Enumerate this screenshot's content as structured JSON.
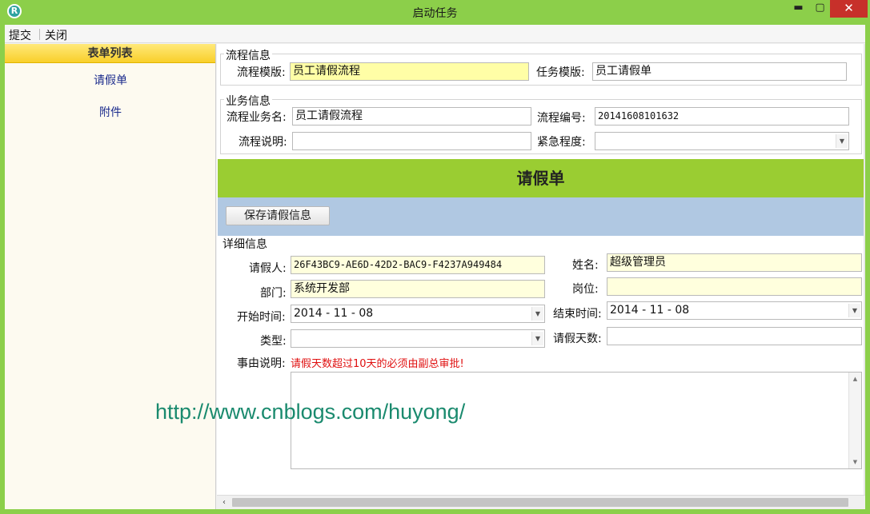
{
  "window": {
    "title": "启动任务",
    "icon_letter": "R"
  },
  "window_buttons": {
    "minimize": "▬",
    "maximize": "▢",
    "close": "✕"
  },
  "menu": {
    "submit": "提交",
    "close": "关闭"
  },
  "sidebar": {
    "title": "表单列表",
    "items": [
      {
        "label": "请假单"
      },
      {
        "label": "附件"
      }
    ]
  },
  "process_info": {
    "legend": "流程信息",
    "template_label": "流程模版:",
    "template_value": "员工请假流程",
    "task_template_label": "任务模版:",
    "task_template_value": "员工请假单"
  },
  "business_info": {
    "legend": "业务信息",
    "name_label": "流程业务名:",
    "name_value": "员工请假流程",
    "number_label": "流程编号:",
    "number_value": "20141608101632",
    "desc_label": "流程说明:",
    "desc_value": "",
    "urgency_label": "紧急程度:",
    "urgency_value": ""
  },
  "form": {
    "title": "请假单",
    "save_button": "保存请假信息",
    "details_legend": "详细信息",
    "applicant_label": "请假人:",
    "applicant_value": "26F43BC9-AE6D-42D2-BAC9-F4237A949484",
    "name_label": "姓名:",
    "name_value": "超级管理员",
    "dept_label": "部门:",
    "dept_value": "系统开发部",
    "position_label": "岗位:",
    "position_value": "",
    "start_label": "开始时间:",
    "start_value": "2014 - 11 - 08",
    "end_label": "结束时间:",
    "end_value": "2014 - 11 - 08",
    "type_label": "类型:",
    "type_value": "",
    "days_label": "请假天数:",
    "days_value": "",
    "reason_label": "事由说明:",
    "reason_note": "请假天数超过10天的必须由副总审批!",
    "reason_value": ""
  },
  "watermark": "http://www.cnblogs.com/huyong/",
  "colors": {
    "green_band": "#9acd32",
    "blue_band": "#b0c8e2",
    "close_button": "#c7302a",
    "note_red": "#e01010"
  }
}
